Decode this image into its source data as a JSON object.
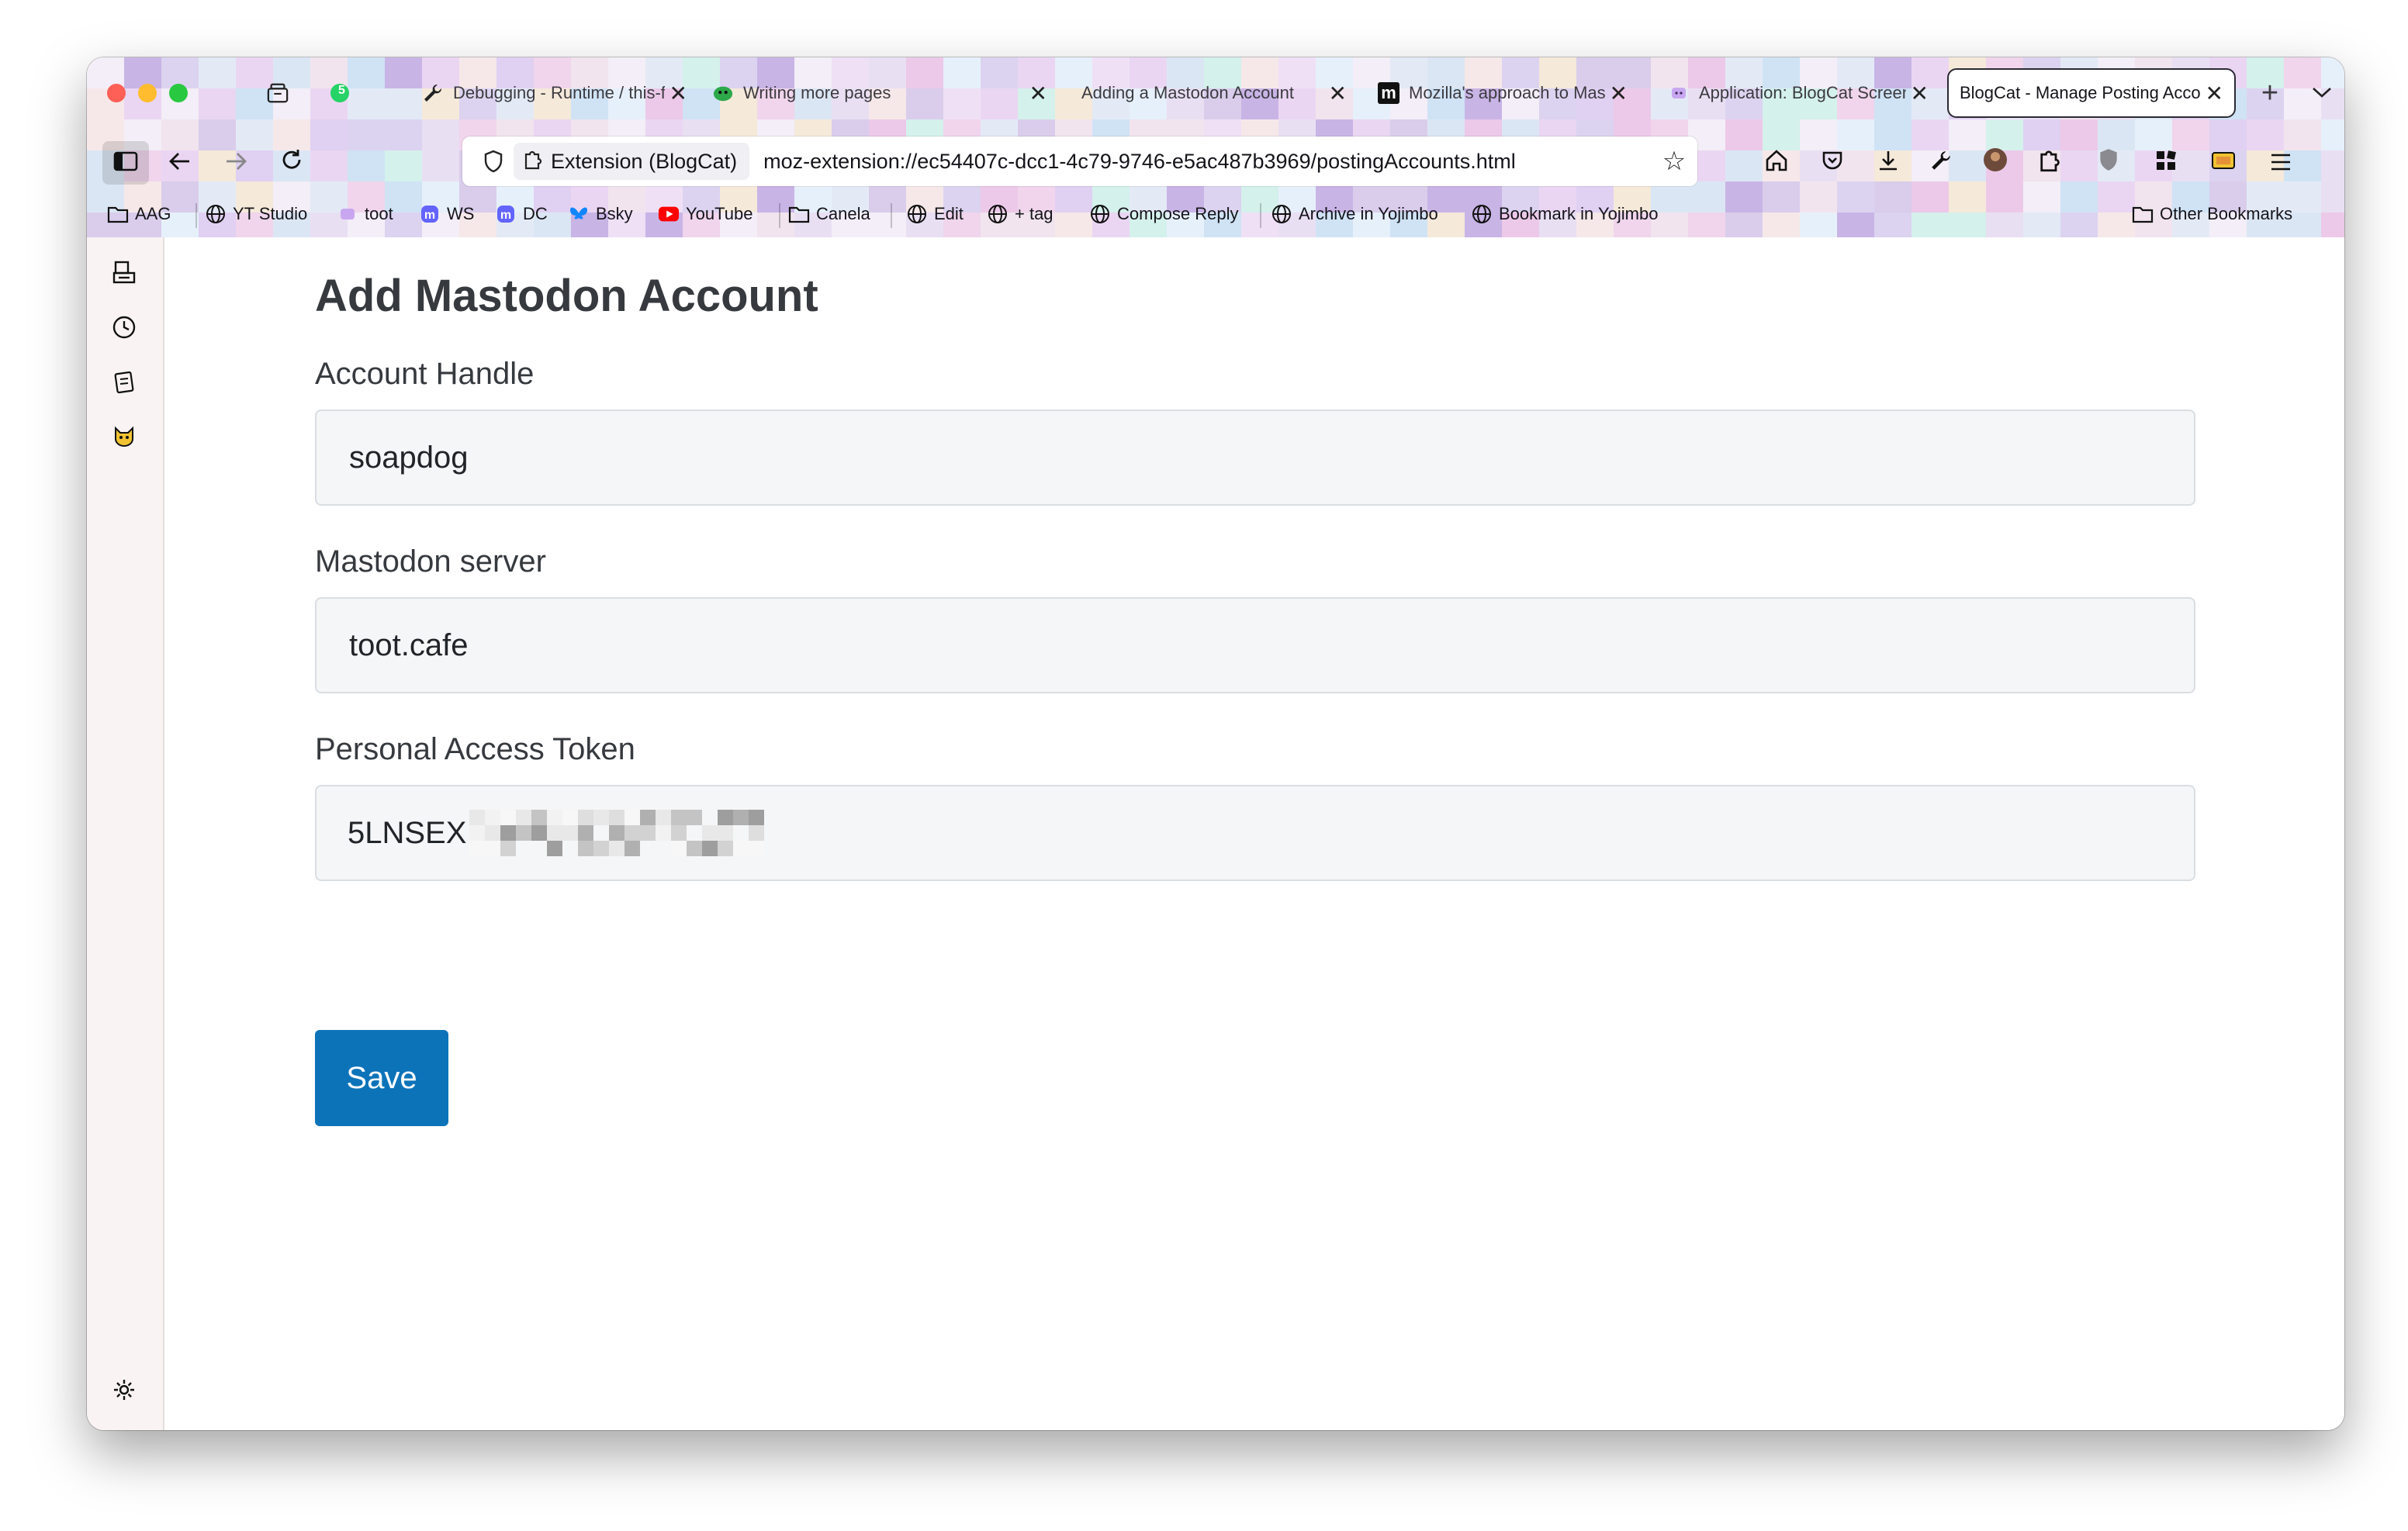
{
  "tabs": [
    {
      "title": "",
      "icon": "tab-manager-icon",
      "close": ""
    },
    {
      "title": "",
      "icon": "whatsapp-icon",
      "badge": "5",
      "close": ""
    },
    {
      "title": "Debugging - Runtime / this-firefox",
      "icon": "wrench-icon",
      "close": "✕"
    },
    {
      "title": "Writing more pages",
      "icon": "green-blob-icon",
      "close": "✕"
    },
    {
      "title": "Adding a Mastodon Account",
      "icon": "",
      "close": "✕"
    },
    {
      "title": "Mozilla's approach to Mastodon",
      "icon": "medium-m-icon",
      "close": "✕"
    },
    {
      "title": "Application: BlogCat Screen",
      "icon": "blogcat-icon",
      "close": "✕"
    },
    {
      "title": "BlogCat - Manage Posting Accounts",
      "icon": "",
      "close": "✕"
    }
  ],
  "tabbar": {
    "new_tab": "+",
    "list_tabs": "⌄"
  },
  "urlbar": {
    "extension_label": "Extension (BlogCat)",
    "url": "moz-extension://ec54407c-dcc1-4c79-9746-e5ac487b3969/postingAccounts.html"
  },
  "bookmarks": [
    {
      "label": "AAG",
      "icon": "folder-icon"
    },
    {
      "label": "YT Studio",
      "icon": "globe-icon"
    },
    {
      "label": "toot",
      "icon": "toot-icon"
    },
    {
      "label": "WS",
      "icon": "mastodon-icon"
    },
    {
      "label": "DC",
      "icon": "mastodon-icon"
    },
    {
      "label": "Bsky",
      "icon": "butterfly-icon"
    },
    {
      "label": "YouTube",
      "icon": "youtube-icon"
    },
    {
      "label": "Canela",
      "icon": "folder-icon"
    },
    {
      "label": "Edit",
      "icon": "globe-icon"
    },
    {
      "label": "+ tag",
      "icon": "globe-icon"
    },
    {
      "label": "Compose Reply",
      "icon": "globe-icon"
    },
    {
      "label": "Archive in Yojimbo",
      "icon": "globe-icon"
    },
    {
      "label": "Bookmark in Yojimbo",
      "icon": "globe-icon"
    },
    {
      "label": "Other Bookmarks",
      "icon": "folder-icon"
    }
  ],
  "form": {
    "title": "Add Mastodon Account",
    "handle_label": "Account Handle",
    "handle_value": "soapdog",
    "server_label": "Mastodon server",
    "server_value": "toot.cafe",
    "token_label": "Personal Access Token",
    "token_visible_prefix": "5LNSEX",
    "save_label": "Save"
  },
  "colors": {
    "save_button": "#0d73b9",
    "heading_text": "#363a3f",
    "field_background": "#f5f6f7"
  }
}
